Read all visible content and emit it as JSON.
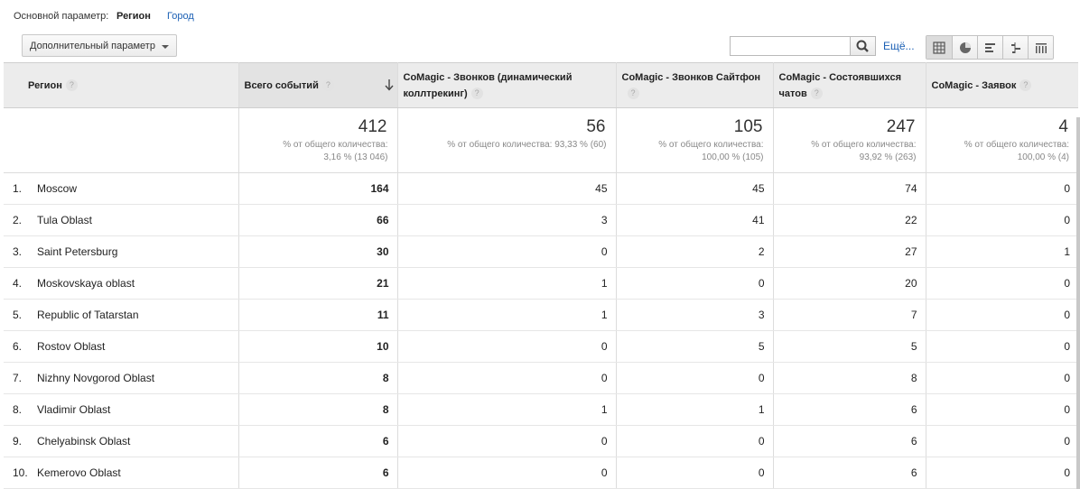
{
  "dimension_bar": {
    "label": "Основной параметр:",
    "selected": "Регион",
    "alternative": "Город"
  },
  "toolbar": {
    "secondary_dimension": "Дополнительный параметр",
    "search_value": "",
    "more_link": "Ещё...",
    "view_icons": [
      "table-view-icon",
      "pie-view-icon",
      "performance-view-icon",
      "comparison-view-icon",
      "pivot-view-icon"
    ]
  },
  "table": {
    "headers": [
      {
        "label": "Регион"
      },
      {
        "label": "Всего событий"
      },
      {
        "label": "CoMagic - Звонков (динамический коллтрекинг)"
      },
      {
        "label": "CoMagic - Звонков Сайтфон"
      },
      {
        "label": "CoMagic - Состоявшихся чатов"
      },
      {
        "label": "CoMagic - Заявок"
      }
    ],
    "totals": [
      {
        "value": "412",
        "line1": "% от общего количества:",
        "line2": "3,16 % (13 046)"
      },
      {
        "value": "56",
        "line1": "% от общего количества: 93,33 % (60)",
        "line2": ""
      },
      {
        "value": "105",
        "line1": "% от общего количества:",
        "line2": "100,00 % (105)"
      },
      {
        "value": "247",
        "line1": "% от общего количества:",
        "line2": "93,92 % (263)"
      },
      {
        "value": "4",
        "line1": "% от общего количества:",
        "line2": "100,00 % (4)"
      }
    ],
    "rows": [
      {
        "index": "1.",
        "name": "Moscow",
        "cells": [
          "164",
          "45",
          "45",
          "74",
          "0"
        ]
      },
      {
        "index": "2.",
        "name": "Tula Oblast",
        "cells": [
          "66",
          "3",
          "41",
          "22",
          "0"
        ]
      },
      {
        "index": "3.",
        "name": "Saint Petersburg",
        "cells": [
          "30",
          "0",
          "2",
          "27",
          "1"
        ]
      },
      {
        "index": "4.",
        "name": "Moskovskaya oblast",
        "cells": [
          "21",
          "1",
          "0",
          "20",
          "0"
        ]
      },
      {
        "index": "5.",
        "name": "Republic of Tatarstan",
        "cells": [
          "11",
          "1",
          "3",
          "7",
          "0"
        ]
      },
      {
        "index": "6.",
        "name": "Rostov Oblast",
        "cells": [
          "10",
          "0",
          "5",
          "5",
          "0"
        ]
      },
      {
        "index": "7.",
        "name": "Nizhny Novgorod Oblast",
        "cells": [
          "8",
          "0",
          "0",
          "8",
          "0"
        ]
      },
      {
        "index": "8.",
        "name": "Vladimir Oblast",
        "cells": [
          "8",
          "1",
          "1",
          "6",
          "0"
        ]
      },
      {
        "index": "9.",
        "name": "Chelyabinsk Oblast",
        "cells": [
          "6",
          "0",
          "0",
          "6",
          "0"
        ]
      },
      {
        "index": "10.",
        "name": "Kemerovo Oblast",
        "cells": [
          "6",
          "0",
          "0",
          "6",
          "0"
        ]
      }
    ]
  }
}
